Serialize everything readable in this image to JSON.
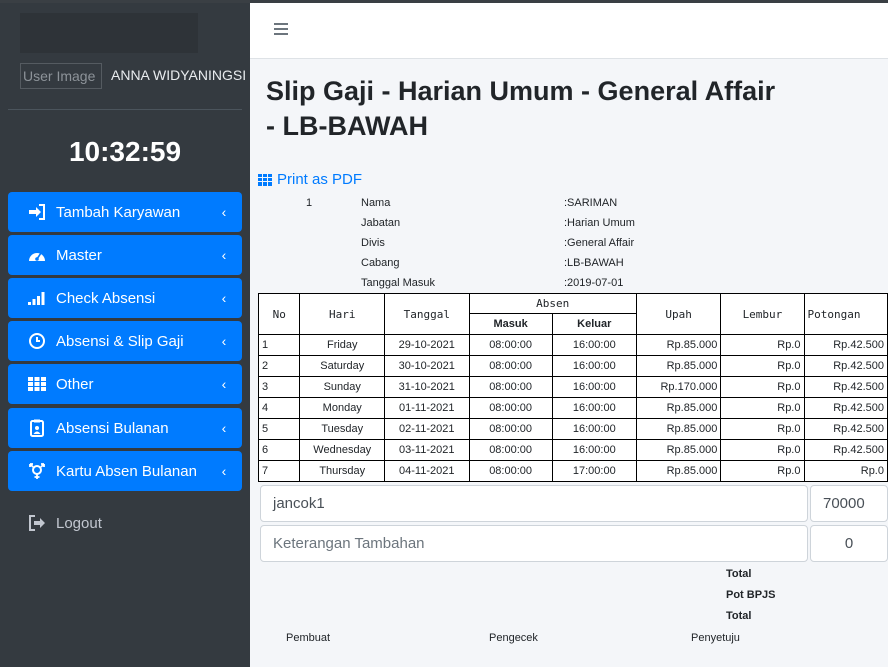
{
  "sidebar": {
    "user_image_alt": "User Image",
    "user_name": "ANNA WIDYANINGSI",
    "clock": "10:32:59",
    "items": [
      {
        "label": "Tambah Karyawan",
        "icon": "sign-in-icon"
      },
      {
        "label": "Master",
        "icon": "dashboard-icon"
      },
      {
        "label": "Check Absensi",
        "icon": "signal-icon"
      },
      {
        "label": "Absensi & Slip Gaji",
        "icon": "clock-icon"
      },
      {
        "label": "Other",
        "icon": "grid-icon"
      },
      {
        "label": "Absensi Bulanan",
        "icon": "clipboard-icon"
      },
      {
        "label": "Kartu Absen Bulanan",
        "icon": "gender-icon"
      }
    ],
    "logout": "Logout"
  },
  "page": {
    "title": "Slip Gaji - Harian Umum - General Affair - LB-BAWAH",
    "print_label": "Print as PDF"
  },
  "employee": {
    "index": "1",
    "rows": [
      {
        "label": "Nama",
        "value": ":SARIMAN"
      },
      {
        "label": "Jabatan",
        "value": ":Harian Umum"
      },
      {
        "label": "Divis",
        "value": ":General Affair"
      },
      {
        "label": "Cabang",
        "value": ":LB-BAWAH"
      },
      {
        "label": "Tanggal Masuk",
        "value": ":2019-07-01"
      }
    ]
  },
  "table": {
    "headers": {
      "no": "No",
      "hari": "Hari",
      "tanggal": "Tanggal",
      "absen": "Absen",
      "masuk": "Masuk",
      "keluar": "Keluar",
      "upah": "Upah",
      "lembur": "Lembur",
      "potongan": "Potongan"
    },
    "rows": [
      {
        "no": "1",
        "hari": "Friday",
        "tanggal": "29-10-2021",
        "masuk": "08:00:00",
        "keluar": "16:00:00",
        "upah": "Rp.85.000",
        "lembur": "Rp.0",
        "potongan": "Rp.42.500"
      },
      {
        "no": "2",
        "hari": "Saturday",
        "tanggal": "30-10-2021",
        "masuk": "08:00:00",
        "keluar": "16:00:00",
        "upah": "Rp.85.000",
        "lembur": "Rp.0",
        "potongan": "Rp.42.500"
      },
      {
        "no": "3",
        "hari": "Sunday",
        "tanggal": "31-10-2021",
        "masuk": "08:00:00",
        "keluar": "16:00:00",
        "upah": "Rp.170.000",
        "lembur": "Rp.0",
        "potongan": "Rp.42.500"
      },
      {
        "no": "4",
        "hari": "Monday",
        "tanggal": "01-11-2021",
        "masuk": "08:00:00",
        "keluar": "16:00:00",
        "upah": "Rp.85.000",
        "lembur": "Rp.0",
        "potongan": "Rp.42.500"
      },
      {
        "no": "5",
        "hari": "Tuesday",
        "tanggal": "02-11-2021",
        "masuk": "08:00:00",
        "keluar": "16:00:00",
        "upah": "Rp.85.000",
        "lembur": "Rp.0",
        "potongan": "Rp.42.500"
      },
      {
        "no": "6",
        "hari": "Wednesday",
        "tanggal": "03-11-2021",
        "masuk": "08:00:00",
        "keluar": "16:00:00",
        "upah": "Rp.85.000",
        "lembur": "Rp.0",
        "potongan": "Rp.42.500"
      },
      {
        "no": "7",
        "hari": "Thursday",
        "tanggal": "04-11-2021",
        "masuk": "08:00:00",
        "keluar": "17:00:00",
        "upah": "Rp.85.000",
        "lembur": "Rp.0",
        "potongan": "Rp.0"
      }
    ]
  },
  "inputs": {
    "item_value": "jancok1",
    "item_amount": "70000",
    "keterangan_placeholder": "Keterangan Tambahan",
    "keterangan_amount": "0"
  },
  "totals": {
    "total": "Total",
    "pot_bpjs": "Pot BPJS",
    "total2": "Total"
  },
  "signatures": {
    "pembuat": "Pembuat",
    "pengecek": "Pengecek",
    "penyetuju": "Penyetuju"
  },
  "colors": {
    "sidebar_bg": "#343a40",
    "nav_active": "#007bff",
    "link": "#007bff"
  }
}
